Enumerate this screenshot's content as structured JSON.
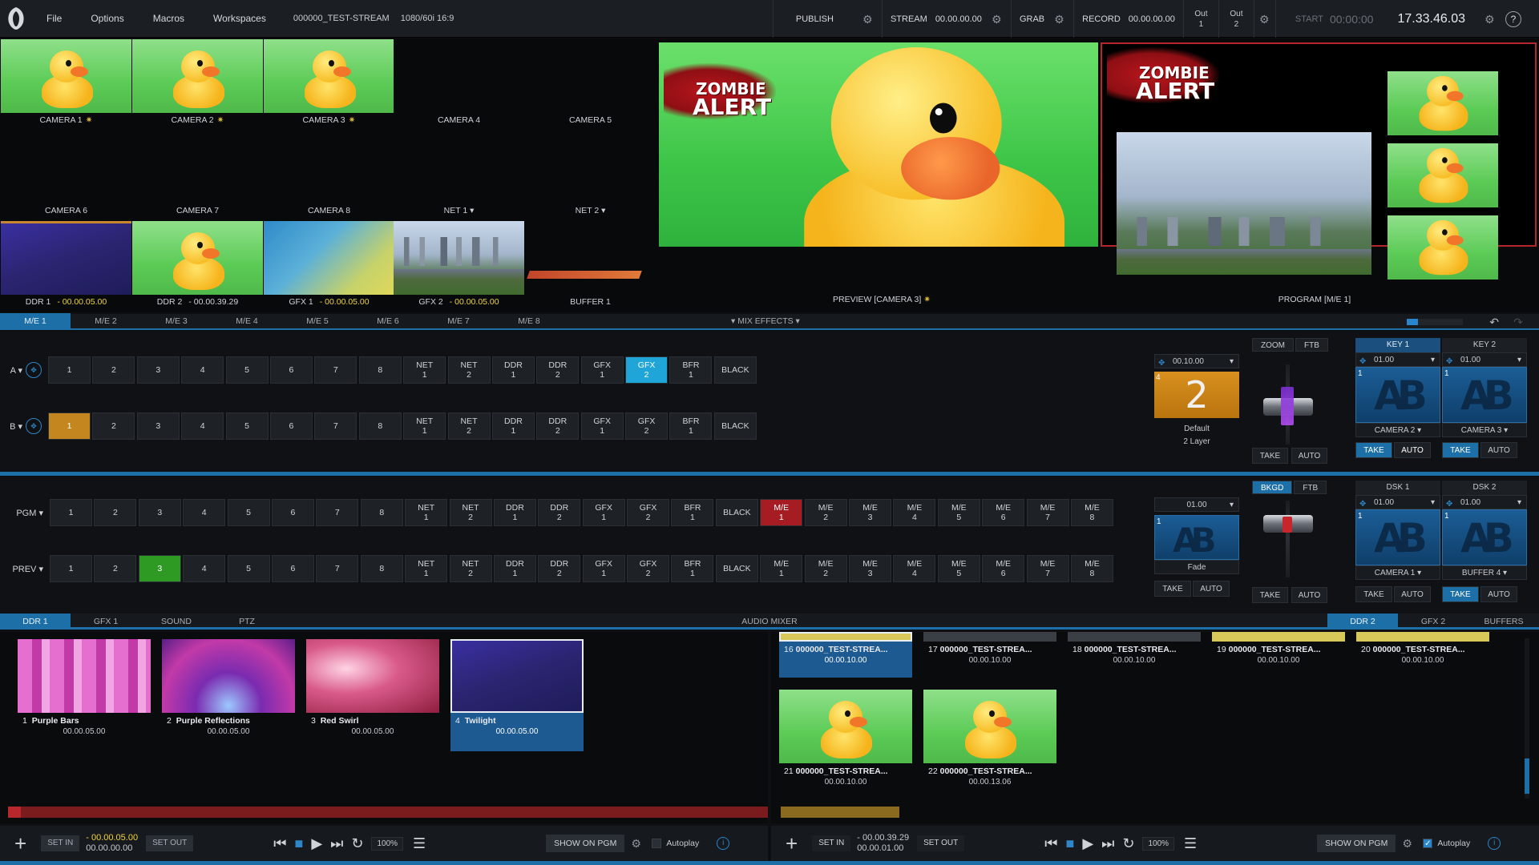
{
  "topbar": {
    "menu": [
      "File",
      "Options",
      "Macros",
      "Workspaces"
    ],
    "session": "000000_TEST-STREAM",
    "format": "1080/60i 16:9",
    "publish": "PUBLISH",
    "stream_label": "STREAM",
    "stream_time": "00.00.00.00",
    "grab": "GRAB",
    "record_label": "RECORD",
    "record_time": "00.00.00.00",
    "out1_a": "Out",
    "out1_b": "1",
    "out2_a": "Out",
    "out2_b": "2",
    "start_label": "START",
    "start_time": "00:00:00",
    "clock": "17.33.46.03",
    "help": "?"
  },
  "sources_top": [
    {
      "label": "CAMERA 1",
      "live": true
    },
    {
      "label": "CAMERA 2",
      "live": true
    },
    {
      "label": "CAMERA 3",
      "live": true
    },
    {
      "label": "CAMERA 4",
      "live": false
    },
    {
      "label": "CAMERA 5",
      "live": false
    }
  ],
  "sources_mid": [
    "CAMERA 6",
    "CAMERA 7",
    "CAMERA 8",
    "NET 1",
    "NET 2"
  ],
  "sources_bottom": [
    {
      "label": "DDR 1",
      "tc": "- 00.00.05.00"
    },
    {
      "label": "DDR 2",
      "tc": "- 00.00.39.29"
    },
    {
      "label": "GFX 1",
      "tc": "- 00.00.05.00"
    },
    {
      "label": "GFX 2",
      "tc": "- 00.00.05.00"
    },
    {
      "label": "BUFFER 1",
      "tc": ""
    }
  ],
  "overlay": {
    "line1": "ZOMBIE",
    "line2": "ALERT"
  },
  "preview_label": "PREVIEW [CAMERA 3]",
  "program_label": "PROGRAM [M/E 1]",
  "me_tabs": [
    "M/E 1",
    "M/E 2",
    "M/E 3",
    "M/E 4",
    "M/E 5",
    "M/E 6",
    "M/E 7",
    "M/E 8"
  ],
  "mix_effects": "MIX EFFECTS",
  "row_a": {
    "label": "A",
    "buttons": [
      "1",
      "2",
      "3",
      "4",
      "5",
      "6",
      "7",
      "8",
      "NET\n1",
      "NET\n2",
      "DDR\n1",
      "DDR\n2",
      "GFX\n1",
      "GFX\n2",
      "BFR\n1",
      "BLACK"
    ],
    "active": 13
  },
  "row_b": {
    "label": "B",
    "buttons": [
      "1",
      "2",
      "3",
      "4",
      "5",
      "6",
      "7",
      "8",
      "NET\n1",
      "NET\n2",
      "DDR\n1",
      "DDR\n2",
      "GFX\n1",
      "GFX\n2",
      "BFR\n1",
      "BLACK"
    ],
    "active": 0
  },
  "row_pgm": {
    "label": "PGM",
    "buttons": [
      "1",
      "2",
      "3",
      "4",
      "5",
      "6",
      "7",
      "8",
      "NET\n1",
      "NET\n2",
      "DDR\n1",
      "DDR\n2",
      "GFX\n1",
      "GFX\n2",
      "BFR\n1",
      "BLACK",
      "M/E\n1",
      "M/E\n2",
      "M/E\n3",
      "M/E\n4",
      "M/E\n5",
      "M/E\n6",
      "M/E\n7",
      "M/E\n8"
    ],
    "active": 16
  },
  "row_prev": {
    "label": "PREV",
    "buttons": [
      "1",
      "2",
      "3",
      "4",
      "5",
      "6",
      "7",
      "8",
      "NET\n1",
      "NET\n2",
      "DDR\n1",
      "DDR\n2",
      "GFX\n1",
      "GFX\n2",
      "BFR\n1",
      "BLACK",
      "M/E\n1",
      "M/E\n2",
      "M/E\n3",
      "M/E\n4",
      "M/E\n5",
      "M/E\n6",
      "M/E\n7",
      "M/E\n8"
    ],
    "active": 2
  },
  "me_trans": {
    "duration": "00.10.00",
    "number": "2",
    "name": "Default",
    "layers": "2 Layer",
    "num_tag": "4"
  },
  "me_bar": {
    "zoom": "ZOOM",
    "ftb": "FTB",
    "take": "TAKE",
    "auto": "AUTO"
  },
  "keys": [
    {
      "name": "KEY 1",
      "value": "01.00",
      "source": "CAMERA 2",
      "num": "1"
    },
    {
      "name": "KEY 2",
      "value": "01.00",
      "source": "CAMERA 3",
      "num": "1"
    }
  ],
  "key_take": "TAKE",
  "key_auto": "AUTO",
  "main_trans": {
    "duration": "01.00",
    "name": "Fade",
    "num": "1"
  },
  "main_bar": {
    "bkgd": "BKGD",
    "ftb": "FTB",
    "take": "TAKE",
    "auto": "AUTO"
  },
  "dsks": [
    {
      "name": "DSK 1",
      "value": "01.00",
      "source": "CAMERA 1",
      "num": "1"
    },
    {
      "name": "DSK 2",
      "value": "01.00",
      "source": "BUFFER 4",
      "num": "1"
    }
  ],
  "media_tabs_left": [
    "DDR 1",
    "GFX 1",
    "SOUND",
    "PTZ"
  ],
  "audio_mixer": "AUDIO MIXER",
  "media_tabs_right": [
    "DDR 2",
    "GFX 2",
    "BUFFERS"
  ],
  "ddr1_clips": [
    {
      "idx": "1",
      "name": "Purple Bars",
      "dur": "00.00.05.00",
      "color": "#c23aa8"
    },
    {
      "idx": "2",
      "name": "Purple Reflections",
      "dur": "00.00.05.00",
      "color": "#7a2bb0"
    },
    {
      "idx": "3",
      "name": "Red Swirl",
      "dur": "00.00.05.00",
      "color": "#d95a8a"
    },
    {
      "idx": "4",
      "name": "Twilight",
      "dur": "00.00.05.00",
      "color": "#2f2a7a",
      "selected": true
    }
  ],
  "ddr2_clips_top": [
    {
      "idx": "16",
      "name": "000000_TEST-STREA...",
      "dur": "00.00.10.00",
      "selected": true
    },
    {
      "idx": "17",
      "name": "000000_TEST-STREA...",
      "dur": "00.00.10.00"
    },
    {
      "idx": "18",
      "name": "000000_TEST-STREA...",
      "dur": "00.00.10.00"
    },
    {
      "idx": "19",
      "name": "000000_TEST-STREA...",
      "dur": "00.00.10.00"
    },
    {
      "idx": "20",
      "name": "000000_TEST-STREA...",
      "dur": "00.00.10.00"
    }
  ],
  "ddr2_clips_bottom": [
    {
      "idx": "21",
      "name": "000000_TEST-STREA...",
      "dur": "00.00.10.00"
    },
    {
      "idx": "22",
      "name": "000000_TEST-STREA...",
      "dur": "00.00.13.06"
    }
  ],
  "transport_left": {
    "set_in": "SET IN",
    "set_out": "SET OUT",
    "tc1": "- 00.00.05.00",
    "tc2": "00.00.00.00",
    "zoom": "100%",
    "show": "SHOW ON PGM",
    "autoplay": "Autoplay",
    "autoplay_on": false,
    "info": "i"
  },
  "transport_right": {
    "set_in": "SET IN",
    "set_out": "SET OUT",
    "tc1": "- 00.00.39.29",
    "tc2": "00.00.01.00",
    "zoom": "100%",
    "show": "SHOW ON PGM",
    "autoplay": "Autoplay",
    "autoplay_on": true,
    "info": "i"
  },
  "colors": {
    "accent": "#1d6fa8",
    "program": "#a51d22",
    "preview": "#2f9a23",
    "selected_b": "#c4861e",
    "selected_a": "#1fa5d8"
  }
}
